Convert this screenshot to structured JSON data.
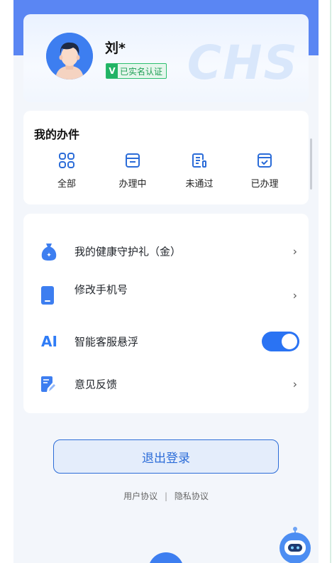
{
  "profile": {
    "name": "刘*",
    "verify_badge": "已实名认证",
    "verify_mark": "V",
    "watermark": "CHS"
  },
  "affairs": {
    "title": "我的办件",
    "items": [
      {
        "label": "全部",
        "icon": "grid-icon"
      },
      {
        "label": "办理中",
        "icon": "folder-icon"
      },
      {
        "label": "未通过",
        "icon": "document-edit-icon"
      },
      {
        "label": "已办理",
        "icon": "check-folder-icon"
      }
    ]
  },
  "menu": {
    "items": [
      {
        "label": "我的健康守护礼（金）",
        "icon": "gift-bag-icon",
        "action": "chevron"
      },
      {
        "label": "修改手机号",
        "icon": "phone-icon",
        "action": "chevron"
      },
      {
        "label": "智能客服悬浮",
        "icon": "ai-icon",
        "icon_text": "AI",
        "action": "toggle",
        "toggle_on": true
      },
      {
        "label": "意见反馈",
        "icon": "feedback-icon",
        "action": "chevron"
      }
    ],
    "chevron": "›"
  },
  "logout": {
    "label": "退出登录"
  },
  "footer": {
    "user_agreement": "用户协议",
    "separator": "|",
    "privacy_policy": "隐私协议"
  },
  "colors": {
    "accent": "#2a73f3",
    "header": "#5a86f3",
    "verify_green": "#22b365"
  }
}
